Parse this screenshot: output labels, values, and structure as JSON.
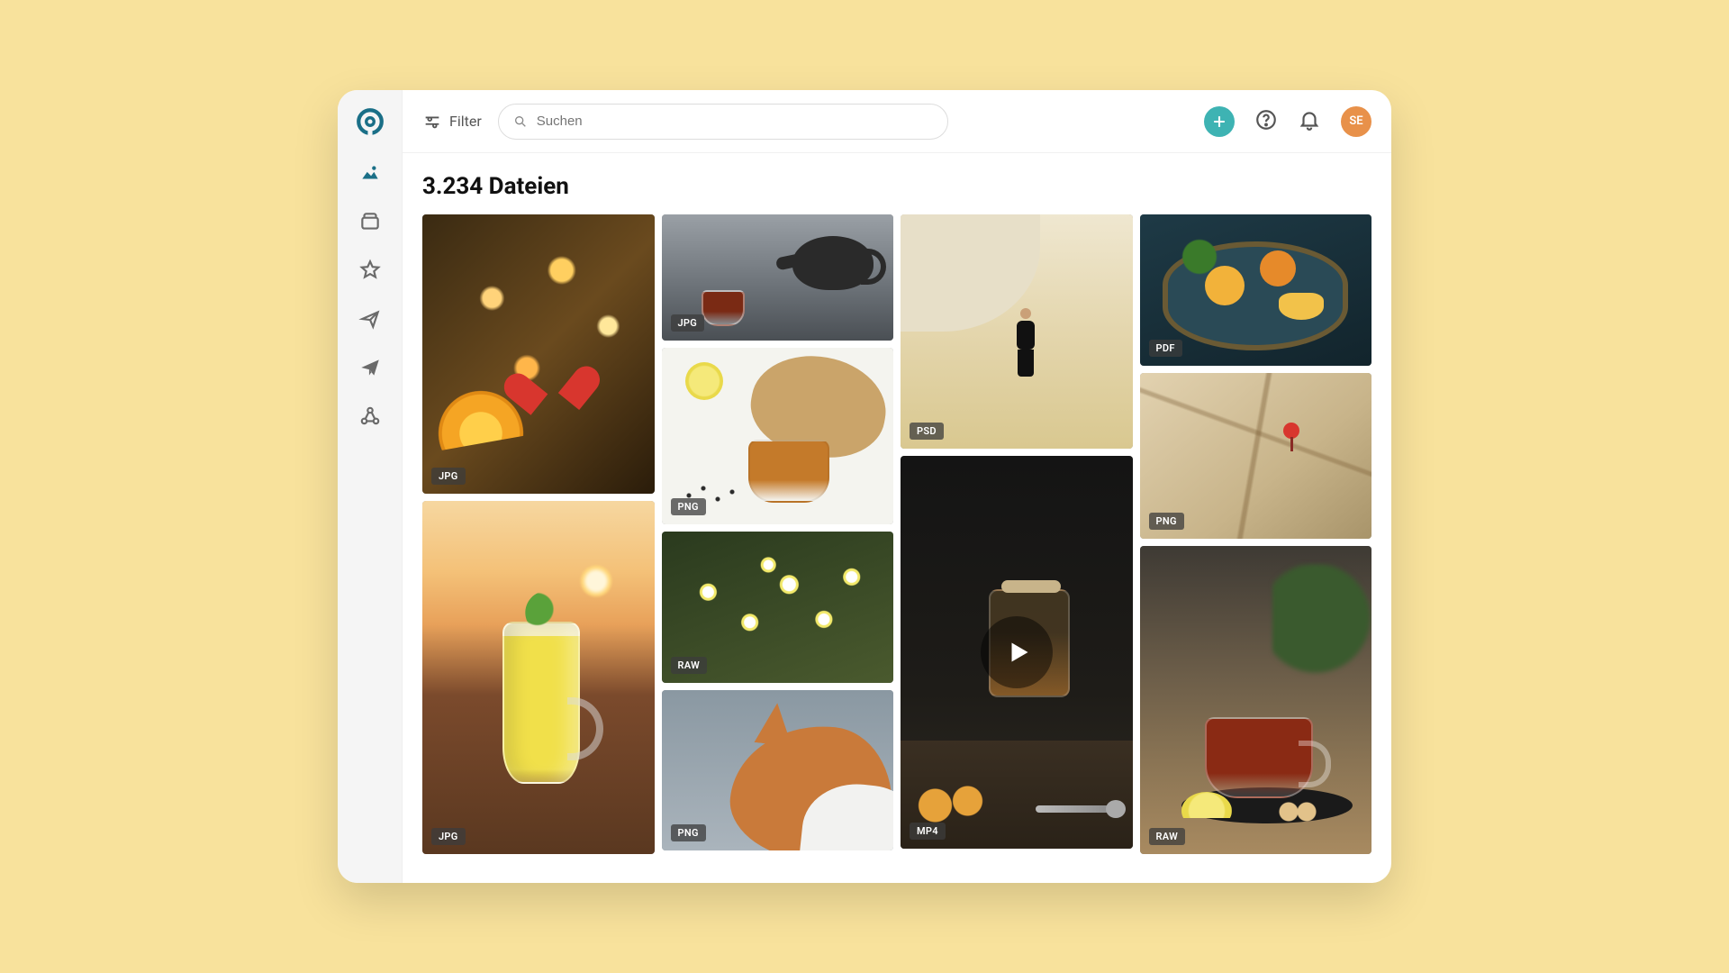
{
  "header": {
    "filter_label": "Filter",
    "search_placeholder": "Suchen",
    "avatar_initials": "SE"
  },
  "page": {
    "title": "3.234 Dateien"
  },
  "tiles": {
    "t1": {
      "badge": "JPG"
    },
    "t2": {
      "badge": "JPG"
    },
    "t3": {
      "badge": "JPG"
    },
    "t4": {
      "badge": "PNG"
    },
    "t5": {
      "badge": "RAW"
    },
    "t6": {
      "badge": "PNG"
    },
    "t7": {
      "badge": "PSD"
    },
    "t8": {
      "badge": "MP4"
    },
    "t9": {
      "badge": "PDF"
    },
    "t10": {
      "badge": "PNG"
    },
    "t11": {
      "badge": "RAW"
    }
  }
}
